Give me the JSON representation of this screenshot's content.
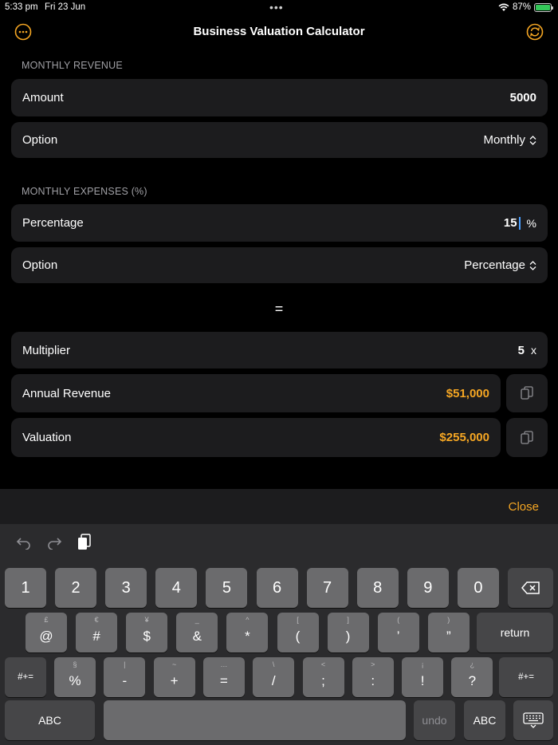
{
  "status": {
    "time": "5:33 pm",
    "date": "Fri 23 Jun",
    "dots": "•••",
    "battery": "87%"
  },
  "nav": {
    "title": "Business Valuation Calculator",
    "left_icon": "ellipsis-circle-icon",
    "right_icon": "refresh-circle-icon"
  },
  "revenue": {
    "header": "MONTHLY REVENUE",
    "amount_label": "Amount",
    "amount_value": "5000",
    "option_label": "Option",
    "option_value": "Monthly"
  },
  "expenses": {
    "header": "MONTHLY EXPENSES (%)",
    "percentage_label": "Percentage",
    "percentage_value": "15",
    "percentage_unit": "%",
    "option_label": "Option",
    "option_value": "Percentage"
  },
  "equals_sign": "=",
  "results": {
    "multiplier_label": "Multiplier",
    "multiplier_value": "5",
    "multiplier_unit": "x",
    "annual_label": "Annual Revenue",
    "annual_value": "$51,000",
    "valuation_label": "Valuation",
    "valuation_value": "$255,000"
  },
  "accessory": {
    "close_label": "Close"
  },
  "keyboard": {
    "row1": [
      "1",
      "2",
      "3",
      "4",
      "5",
      "6",
      "7",
      "8",
      "9",
      "0"
    ],
    "row2": [
      {
        "sub": "£",
        "main": "@"
      },
      {
        "sub": "€",
        "main": "#"
      },
      {
        "sub": "¥",
        "main": "$"
      },
      {
        "sub": "_",
        "main": "&"
      },
      {
        "sub": "^",
        "main": "*"
      },
      {
        "sub": "[",
        "main": "("
      },
      {
        "sub": "]",
        "main": ")"
      },
      {
        "sub": "(",
        "main": "’"
      },
      {
        "sub": ")",
        "main": "”"
      }
    ],
    "return_label": "return",
    "row3": [
      {
        "sub": "§",
        "main": "%"
      },
      {
        "sub": "|",
        "main": "-"
      },
      {
        "sub": "~",
        "main": "+"
      },
      {
        "sub": "…",
        "main": "="
      },
      {
        "sub": "\\",
        "main": "/"
      },
      {
        "sub": "<",
        "main": ";"
      },
      {
        "sub": ">",
        "main": ":"
      },
      {
        "sub": "¡",
        "main": "!"
      },
      {
        "sub": "¿",
        "main": "?"
      }
    ],
    "row3_extra": [
      ",",
      "."
    ],
    "symbols_label": "#+=",
    "abc_label": "ABC",
    "undo_label": "undo",
    "colors": {
      "accent": "#f5a623",
      "key": "#6b6b6d",
      "key_dark": "#464648"
    }
  }
}
